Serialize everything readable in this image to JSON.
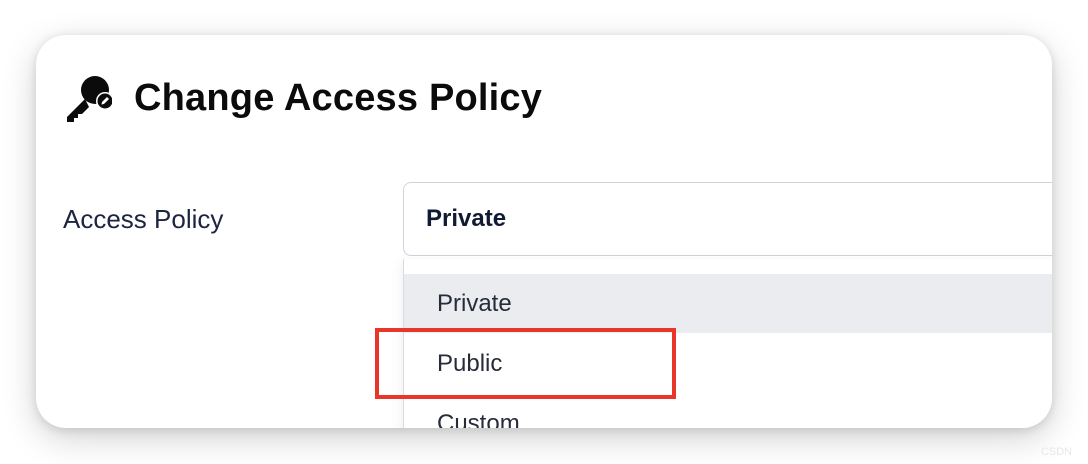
{
  "dialog": {
    "title": "Change Access Policy",
    "icon": "key-icon"
  },
  "form": {
    "field_label": "Access Policy",
    "selected_value": "Private"
  },
  "dropdown": {
    "options": [
      {
        "label": "Private",
        "selected": true
      },
      {
        "label": "Public",
        "selected": false
      },
      {
        "label": "Custom",
        "selected": false
      }
    ]
  },
  "annotation": {
    "highlight_color": "#e8362a",
    "highlighted_option": "Public"
  },
  "watermark": "CSDN"
}
